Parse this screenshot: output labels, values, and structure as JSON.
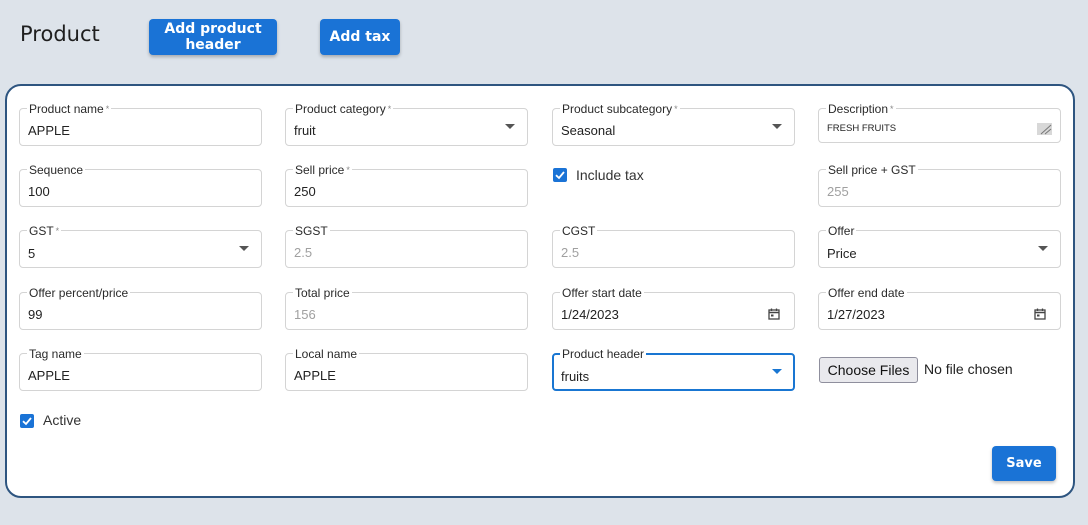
{
  "page_title": "Product",
  "header_buttons": {
    "add_product_header": "Add product header",
    "add_tax": "Add tax"
  },
  "fields": {
    "product_name": {
      "label": "Product name",
      "value": "APPLE",
      "required": "*"
    },
    "product_category": {
      "label": "Product category",
      "value": "fruit",
      "required": "*"
    },
    "product_subcategory": {
      "label": "Product subcategory",
      "value": "Seasonal",
      "required": "*"
    },
    "description": {
      "label": "Description",
      "value": "FRESH FRUITS",
      "required": "*"
    },
    "sequence": {
      "label": "Sequence",
      "value": "100"
    },
    "sell_price": {
      "label": "Sell price",
      "value": "250",
      "required": "*"
    },
    "include_tax": {
      "label": "Include tax",
      "checked": true
    },
    "sell_price_gst": {
      "label": "Sell price + GST",
      "value": "255"
    },
    "gst": {
      "label": "GST",
      "value": "5",
      "required": "*"
    },
    "sgst": {
      "label": "SGST",
      "value": "2.5"
    },
    "cgst": {
      "label": "CGST",
      "value": "2.5"
    },
    "offer": {
      "label": "Offer",
      "value": "Price"
    },
    "offer_percent_price": {
      "label": "Offer percent/price",
      "value": "99"
    },
    "total_price": {
      "label": "Total price",
      "value": "156"
    },
    "offer_start_date": {
      "label": "Offer start date",
      "value": "1/24/2023"
    },
    "offer_end_date": {
      "label": "Offer end date",
      "value": "1/27/2023"
    },
    "tag_name": {
      "label": "Tag name",
      "value": "APPLE"
    },
    "local_name": {
      "label": "Local name",
      "value": "APPLE"
    },
    "product_header": {
      "label": "Product header",
      "value": "fruits"
    }
  },
  "file_input": {
    "button_label": "Choose Files",
    "status": "No file chosen"
  },
  "active": {
    "label": "Active",
    "checked": true
  },
  "save_label": "Save",
  "icons": {
    "dropdown": "chevron-down-icon",
    "calendar": "calendar-icon",
    "resize": "resize-handle-icon",
    "check": "checkmark-icon"
  },
  "colors": {
    "accent": "#1a73d6",
    "card_border": "#2e5580",
    "background": "#dde3ea"
  }
}
